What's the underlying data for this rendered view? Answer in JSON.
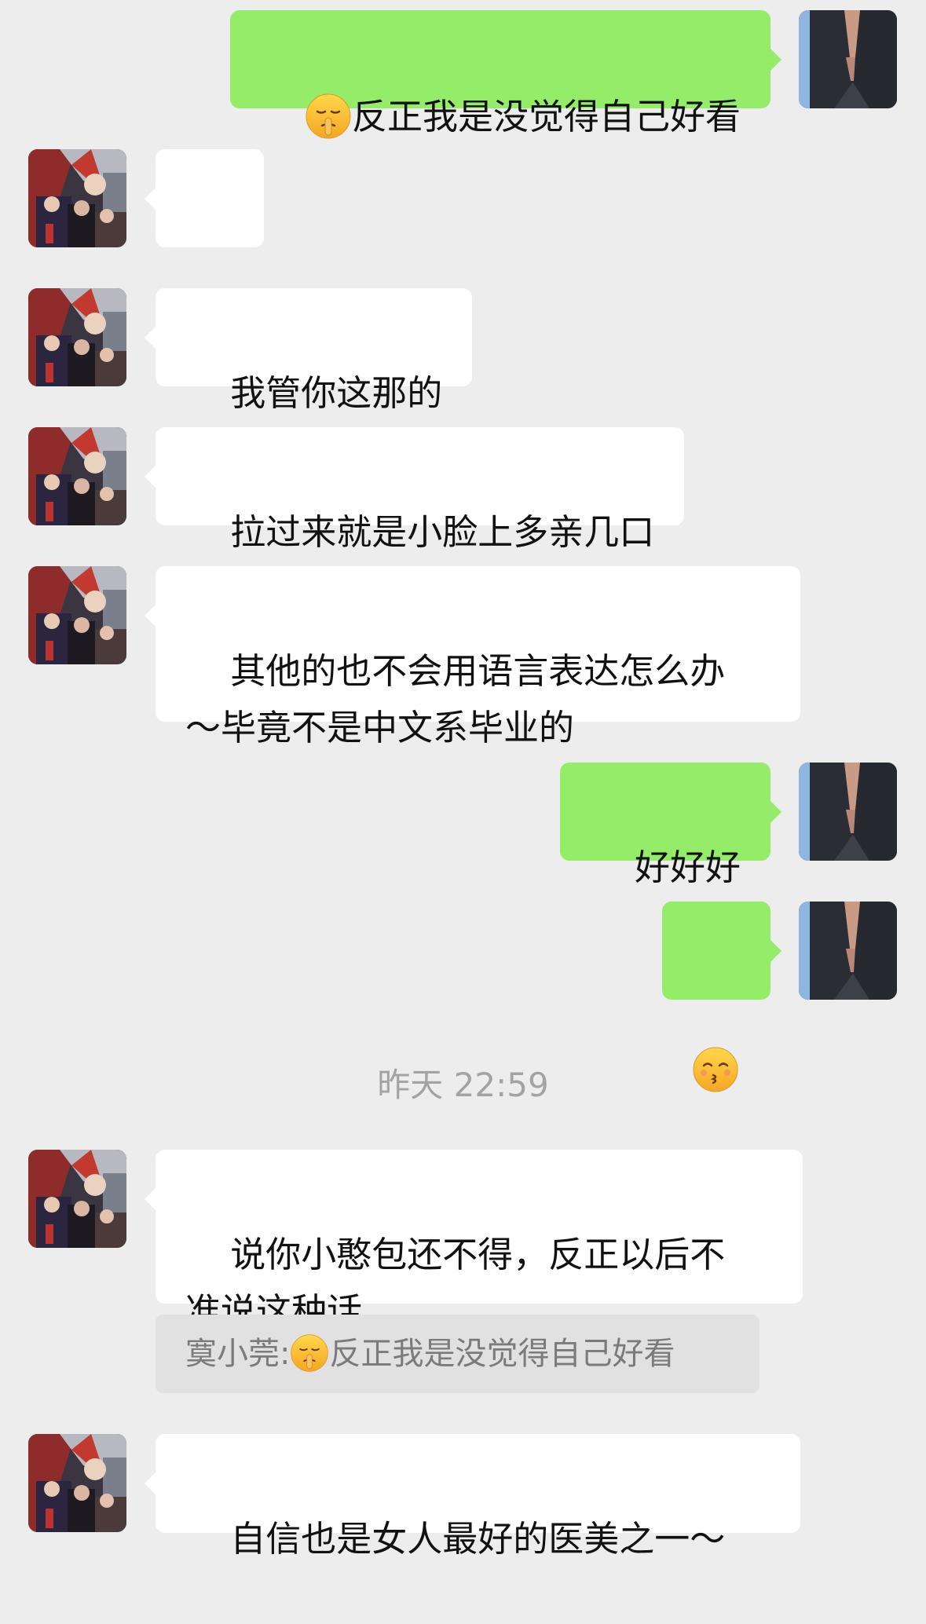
{
  "messages": [
    {
      "id": "m1",
      "side": "out",
      "emoji": "shushing-face",
      "text": "反正我是没觉得自己好看"
    },
    {
      "id": "m2",
      "side": "in",
      "emoji": "kissing-face",
      "text": ""
    },
    {
      "id": "m3",
      "side": "in",
      "text": "我管你这那的"
    },
    {
      "id": "m4",
      "side": "in",
      "text": "拉过来就是小脸上多亲几口"
    },
    {
      "id": "m5",
      "side": "in",
      "text": "其他的也不会用语言表达怎么办\n～毕竟不是中文系毕业的"
    },
    {
      "id": "m6",
      "side": "out",
      "text": "好好好"
    },
    {
      "id": "m7",
      "side": "out",
      "emoji": "kissing-face",
      "text": ""
    },
    {
      "id": "m8",
      "side": "in",
      "text": "说你小憨包还不得，反正以后不\n准说这种话"
    },
    {
      "id": "m9",
      "side": "in",
      "text": "自信也是女人最好的医美之一～"
    }
  ],
  "timestamp": "昨天 22:59",
  "quote": {
    "sender": "寞小莞:",
    "emoji": "shushing-face",
    "text": "反正我是没觉得自己好看"
  },
  "colors": {
    "background": "#ededed",
    "incoming_bubble": "#ffffff",
    "outgoing_bubble": "#95ec69",
    "quote_bg": "#e1e1e1",
    "timestamp_text": "#a3a3a3"
  },
  "icons": {
    "shushing": "shushing-face-emoji",
    "kissing": "kissing-face-emoji",
    "avatar_contact": "contact-avatar-photo",
    "avatar_self": "self-avatar-photo"
  }
}
